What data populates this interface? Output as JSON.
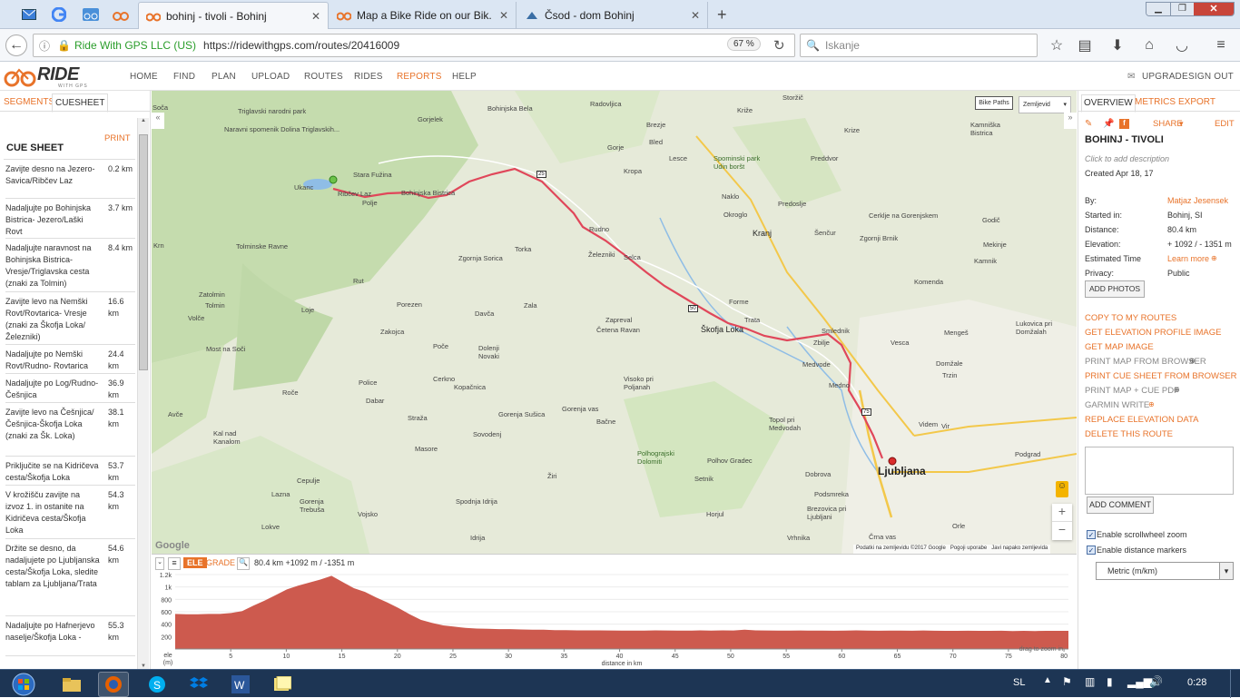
{
  "browser": {
    "tabs": [
      {
        "label": "bohinj - tivoli - Bohinj"
      },
      {
        "label": "Map a Bike Ride on our Bik..."
      },
      {
        "label": "Čsod - dom Bohinj"
      }
    ],
    "identity": "Ride With GPS LLC (US)",
    "url": "https://ridewithgps.com/routes/20416009",
    "zoom": "67 %",
    "search_placeholder": "Iskanje"
  },
  "app": {
    "logo_main": "RIDE",
    "logo_sub": "WITH GPS",
    "nav": [
      "HOME",
      "FIND",
      "PLAN",
      "UPLOAD",
      "ROUTES",
      "RIDES",
      "REPORTS",
      "HELP"
    ],
    "upgrade": "UPGRADE",
    "signout": "SIGN OUT"
  },
  "left": {
    "tabs": [
      "SEGMENTS",
      "CUESHEET"
    ],
    "print": "PRINT",
    "title": "CUE SHEET",
    "cues": [
      {
        "text": "Zavijte desno na Jezero- Savica/Ribčev Laz",
        "dist": "0.2 km"
      },
      {
        "text": "Nadaljujte po Bohinjska Bistrica- Jezero/Laški Rovt",
        "dist": "3.7 km"
      },
      {
        "text": "Nadaljujte naravnost na Bohinjska Bistrica-Vresje/Triglavska cesta (znaki za Tolmin)",
        "dist": "8.4 km"
      },
      {
        "text": "Zavijte levo na Nemški Rovt/Rovtarica- Vresje (znaki za Škofja Loka/Železniki)",
        "dist": "16.6 km"
      },
      {
        "text": "Nadaljujte po Nemški Rovt/Rudno- Rovtarica",
        "dist": "24.4 km"
      },
      {
        "text": "Nadaljujte po Log/Rudno- Češnjica",
        "dist": "36.9 km"
      },
      {
        "text": "Zavijte levo na Češnjica/Češnjica-Škofja Loka (znaki za Šk. Loka)",
        "dist": "38.1 km"
      },
      {
        "text": "Priključite se na Kidričeva cesta/Škofja Loka",
        "dist": "53.7 km"
      },
      {
        "text": "V krožišču zavijte na izvoz 1. in ostanite na Kidričeva cesta/Škofja Loka",
        "dist": "54.3 km"
      },
      {
        "text": "Držite se desno, da nadaljujete po Ljubljanska cesta/Škofja Loka, sledite tablam za Ljubljana/Trata",
        "dist": "54.6 km"
      },
      {
        "text": "Nadaljujte po Hafnerjevo naselje/Škofja Loka -",
        "dist": "55.3 km"
      }
    ]
  },
  "map": {
    "bike_paths": "Bike Paths",
    "map_type": "Zemljevid",
    "attribution": "Podatki na zemljevidu ©2017 Google",
    "terms": "Pogoji uporabe",
    "report": "Javi napako zemljevida",
    "google": "Google",
    "places": [
      {
        "name": "Ljubljana",
        "big": true
      },
      {
        "name": "Kranj"
      },
      {
        "name": "Škofja Loka"
      },
      {
        "name": "Radovljica"
      },
      {
        "name": "Bohinjska Bela"
      },
      {
        "name": "Stara Fužina"
      },
      {
        "name": "Ribčev Laz"
      },
      {
        "name": "Polje"
      },
      {
        "name": "Bohinjska Bistrica"
      },
      {
        "name": "Ukanc"
      },
      {
        "name": "Gorjelek"
      },
      {
        "name": "Triglavski narodni park"
      },
      {
        "name": "Naravni spomenik Dolina Triglavskih..."
      },
      {
        "name": "Tolminske Ravne"
      },
      {
        "name": "Tolmin"
      },
      {
        "name": "Zatolmin"
      },
      {
        "name": "Volče"
      },
      {
        "name": "Most na Soči"
      },
      {
        "name": "Rut"
      },
      {
        "name": "Loje"
      },
      {
        "name": "Porezen"
      },
      {
        "name": "Davča"
      },
      {
        "name": "Zala"
      },
      {
        "name": "Zakojca"
      },
      {
        "name": "Torka"
      },
      {
        "name": "Zgornja Sorica"
      },
      {
        "name": "Železniki"
      },
      {
        "name": "Selca"
      },
      {
        "name": "Rudno"
      },
      {
        "name": "Bled"
      },
      {
        "name": "Gorje"
      },
      {
        "name": "Brezje"
      },
      {
        "name": "Kropa"
      },
      {
        "name": "Lesce"
      },
      {
        "name": "Spominski park Udin boršt"
      },
      {
        "name": "Naklo"
      },
      {
        "name": "Okroglo"
      },
      {
        "name": "Predoslje"
      },
      {
        "name": "Šenčur"
      },
      {
        "name": "Cerklje na Gorenjskem"
      },
      {
        "name": "Zgornji Brnik"
      },
      {
        "name": "Kamnik"
      },
      {
        "name": "Mekinje"
      },
      {
        "name": "Godič"
      },
      {
        "name": "Komenda"
      },
      {
        "name": "Mengeš"
      },
      {
        "name": "Domžale"
      },
      {
        "name": "Trzin"
      },
      {
        "name": "Vesca"
      },
      {
        "name": "Smlednik"
      },
      {
        "name": "Medvode"
      },
      {
        "name": "Trata"
      },
      {
        "name": "Forme"
      },
      {
        "name": "Zbilje"
      },
      {
        "name": "Medno"
      },
      {
        "name": "Polhov Gradec"
      },
      {
        "name": "Polhograjski Dolomiti"
      },
      {
        "name": "Topol pri Medvodah"
      },
      {
        "name": "Dobrova"
      },
      {
        "name": "Brezovica pri Ljubljani"
      },
      {
        "name": "Podsmreka"
      },
      {
        "name": "Horjul"
      },
      {
        "name": "Setnik"
      },
      {
        "name": "Bačne"
      },
      {
        "name": "Gorenja vas"
      },
      {
        "name": "Visoko pri Poljanah"
      },
      {
        "name": "Zapreval"
      },
      {
        "name": "Četena Ravan"
      },
      {
        "name": "Poče"
      },
      {
        "name": "Dolenji Novaki"
      },
      {
        "name": "Cerkno"
      },
      {
        "name": "Police"
      },
      {
        "name": "Dabar"
      },
      {
        "name": "Kopačnica"
      },
      {
        "name": "Straža"
      },
      {
        "name": "Masore"
      },
      {
        "name": "Gorenja Sušica"
      },
      {
        "name": "Sovodenj"
      },
      {
        "name": "Žiri"
      },
      {
        "name": "Spodnja Idrija"
      },
      {
        "name": "Idrija"
      },
      {
        "name": "Cepulje"
      },
      {
        "name": "Lazna"
      },
      {
        "name": "Gorenja Trebuša"
      },
      {
        "name": "Vojsko"
      },
      {
        "name": "Lokve"
      },
      {
        "name": "Kal nad Kanalom"
      },
      {
        "name": "Avče"
      },
      {
        "name": "Roče"
      },
      {
        "name": "Krn"
      },
      {
        "name": "Soča"
      },
      {
        "name": "Kamniška Bistrica"
      },
      {
        "name": "Preddvor"
      },
      {
        "name": "Križe"
      },
      {
        "name": "Storžič"
      },
      {
        "name": "Krize"
      },
      {
        "name": "Podgrad"
      },
      {
        "name": "Lukovica pri Domžalah"
      },
      {
        "name": "Vir"
      },
      {
        "name": "Videm"
      },
      {
        "name": "Orle"
      },
      {
        "name": "Črna vas"
      },
      {
        "name": "Vrhnika"
      }
    ]
  },
  "elevation": {
    "ele": "ELE",
    "grade": "GRADE",
    "summary": "80.4 km +1092 m / -1351 m",
    "y_ticks": [
      "1.2k",
      "1k",
      "800",
      "600",
      "400",
      "200"
    ],
    "x_ticks": [
      "5",
      "10",
      "15",
      "20",
      "25",
      "30",
      "35",
      "40",
      "45",
      "50",
      "55",
      "60",
      "65",
      "70",
      "75",
      "80"
    ],
    "unit_y": "ele (m)",
    "xlabel": "distance in km",
    "hint": "drag to zoom in",
    "profile_m": [
      565,
      560,
      560,
      565,
      565,
      580,
      610,
      700,
      780,
      870,
      960,
      1020,
      1070,
      1120,
      1180,
      1080,
      980,
      920,
      830,
      750,
      660,
      560,
      470,
      420,
      380,
      360,
      340,
      330,
      325,
      320,
      320,
      315,
      310,
      310,
      305,
      305,
      300,
      300,
      300,
      298,
      296,
      295,
      295,
      300,
      298,
      296,
      295,
      300,
      295,
      300,
      298,
      310,
      300,
      298,
      296,
      295,
      298,
      296,
      295,
      294,
      296,
      300,
      295,
      294,
      296,
      295,
      294,
      298,
      294,
      292,
      293,
      294,
      292,
      292,
      294,
      290,
      292,
      290,
      293,
      292,
      292
    ]
  },
  "right": {
    "tabs": [
      "OVERVIEW",
      "METRICS",
      "EXPORT"
    ],
    "share": "SHARE",
    "edit": "EDIT",
    "title": "BOHINJ - TIVOLI",
    "desc_hint": "Click to add description",
    "created": "Created Apr 18, 17",
    "details": [
      {
        "label": "By:",
        "value": "Matjaz Jesensek"
      },
      {
        "label": "Started in:",
        "value": "Bohinj, SI"
      },
      {
        "label": "Distance:",
        "value": "80.4 km"
      },
      {
        "label": "Elevation:",
        "value": "+ 1092 / - 1351 m"
      },
      {
        "label": "Estimated Time",
        "value": "Learn more"
      },
      {
        "label": "Privacy:",
        "value": "Public"
      }
    ],
    "add_photos": "ADD PHOTOS",
    "actions": [
      {
        "label": "COPY TO MY ROUTES",
        "grey": false
      },
      {
        "label": "GET ELEVATION PROFILE IMAGE",
        "grey": false
      },
      {
        "label": "GET MAP IMAGE",
        "grey": false
      },
      {
        "label": "PRINT MAP FROM BROWSER",
        "grey": true
      },
      {
        "label": "PRINT CUE SHEET FROM BROWSER",
        "grey": false
      },
      {
        "label": "PRINT MAP + CUE PDF",
        "grey": true
      },
      {
        "label": "GARMIN WRITE",
        "grey": true
      },
      {
        "label": "REPLACE ELEVATION DATA",
        "grey": false
      },
      {
        "label": "DELETE THIS ROUTE",
        "grey": false
      }
    ],
    "add_comment": "ADD COMMENT",
    "scroll_zoom": "Enable scrollwheel zoom",
    "dist_markers": "Enable distance markers",
    "units": "Metric (m/km)"
  },
  "taskbar": {
    "lang": "SL",
    "time": "0:28"
  },
  "colors": {
    "accent": "#e8732a",
    "route": "#e0475a",
    "profile": "#cd5a4e",
    "taskbar": "#1d3554"
  }
}
